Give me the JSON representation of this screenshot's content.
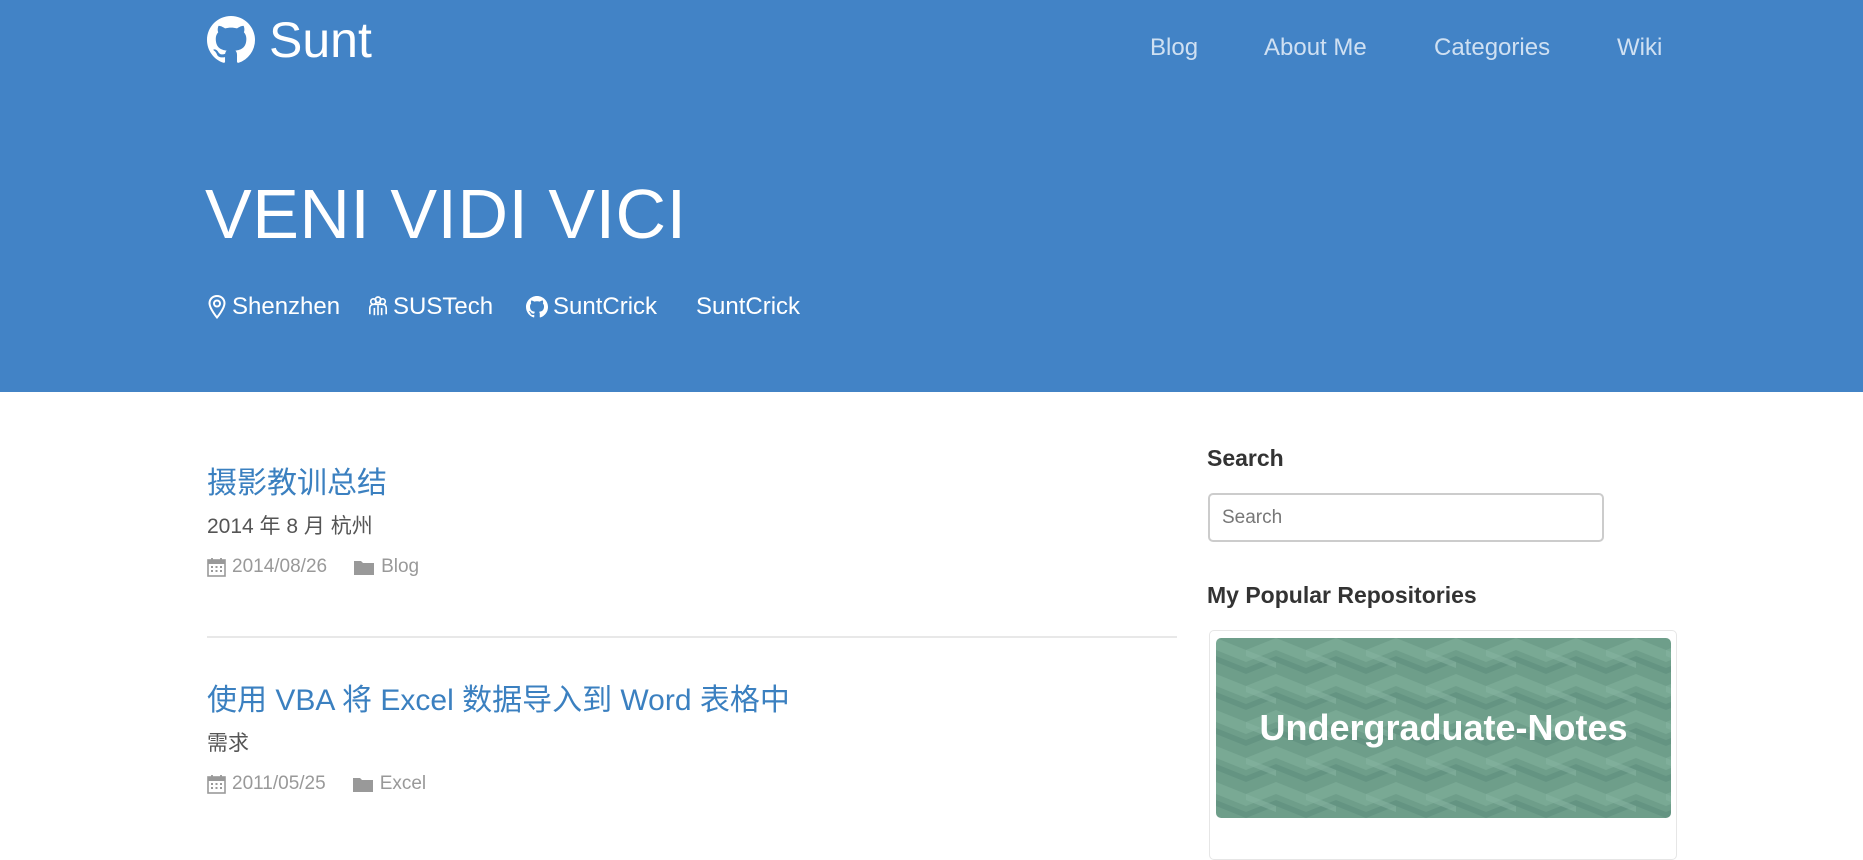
{
  "brand": {
    "name": "Sunt"
  },
  "nav": [
    "Blog",
    "About Me",
    "Categories",
    "Wiki"
  ],
  "hero": {
    "title": "VENI VIDI VICI",
    "meta": [
      {
        "icon": "location-pin-icon",
        "text": "Shenzhen"
      },
      {
        "icon": "organization-icon",
        "text": "SUSTech"
      },
      {
        "icon": "github-icon",
        "text": "SuntCrick"
      },
      {
        "icon": "none",
        "text": "SuntCrick"
      }
    ]
  },
  "posts": [
    {
      "title": "摄影教训总结",
      "excerpt": "2014 年 8 月 杭州",
      "date": "2014/08/26",
      "category": "Blog"
    },
    {
      "title": "使用 VBA 将 Excel 数据导入到 Word 表格中",
      "excerpt": "需求",
      "date": "2011/05/25",
      "category": "Excel"
    }
  ],
  "sidebar": {
    "search_heading": "Search",
    "search_placeholder": "Search",
    "repos_heading": "My Popular Repositories",
    "repos": [
      {
        "name": "Undergraduate-Notes"
      }
    ]
  },
  "colors": {
    "header_bg": "#4283c6",
    "link": "#3b80c0",
    "repo_banner": "#6e9e8a"
  }
}
